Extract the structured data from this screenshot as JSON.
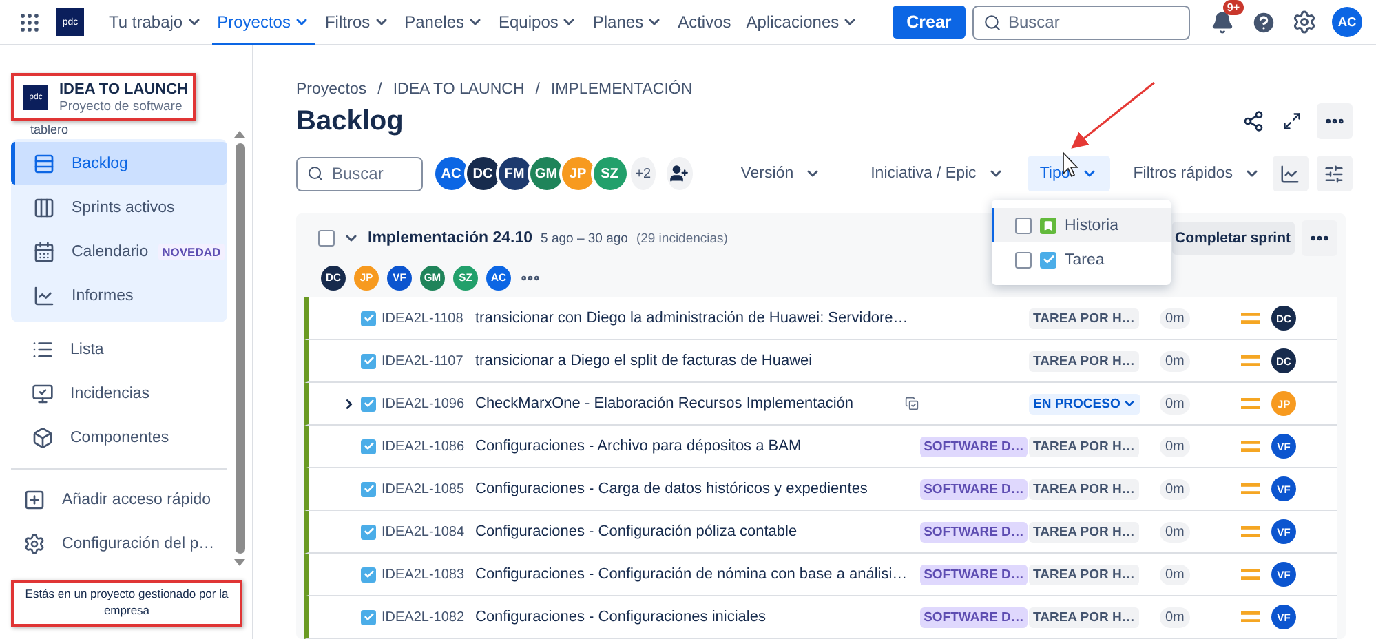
{
  "nav": {
    "logo_text": "pdc",
    "items": [
      {
        "label": "Tu trabajo",
        "dropdown": true,
        "selected": false
      },
      {
        "label": "Proyectos",
        "dropdown": true,
        "selected": true
      },
      {
        "label": "Filtros",
        "dropdown": true,
        "selected": false
      },
      {
        "label": "Paneles",
        "dropdown": true,
        "selected": false
      },
      {
        "label": "Equipos",
        "dropdown": true,
        "selected": false
      },
      {
        "label": "Planes",
        "dropdown": true,
        "selected": false
      },
      {
        "label": "Activos",
        "dropdown": false,
        "selected": false
      },
      {
        "label": "Aplicaciones",
        "dropdown": true,
        "selected": false
      }
    ],
    "create_button": "Crear",
    "search": {
      "placeholder": "Buscar"
    },
    "notifications_badge": "9+",
    "user": {
      "initials": "AC",
      "color": "#0c66e4"
    }
  },
  "sidebar": {
    "project": {
      "logo_text": "pdc",
      "name": "IDEA TO LAUNCH",
      "type": "Proyecto de software"
    },
    "section_label": "tablero",
    "planning_items": [
      {
        "label": "Backlog",
        "selected": true
      },
      {
        "label": "Sprints activos",
        "selected": false
      },
      {
        "label": "Calendario",
        "badge": "NOVEDAD",
        "selected": false
      },
      {
        "label": "Informes",
        "selected": false
      }
    ],
    "items": [
      {
        "label": "Lista",
        "selected": false
      },
      {
        "label": "Incidencias",
        "selected": false
      },
      {
        "label": "Componentes",
        "selected": false
      }
    ],
    "footer_items": [
      {
        "label": "Añadir acceso rápido",
        "selected": false
      },
      {
        "label": "Configuración del p…",
        "selected": false
      }
    ],
    "managed_notice": "Estás en un proyecto gestionado por la empresa"
  },
  "breadcrumbs": {
    "separator": "/",
    "items": [
      "Proyectos",
      "IDEA TO LAUNCH",
      "IMPLEMENTACIÓN"
    ]
  },
  "title": "Backlog",
  "toolbar": {
    "search": {
      "placeholder": "Buscar"
    },
    "avatars": [
      {
        "initials": "AC",
        "color": "#0c66e4"
      },
      {
        "initials": "DC",
        "color": "#172b4d"
      },
      {
        "initials": "FM",
        "color": "#1d3a6e"
      },
      {
        "initials": "GM",
        "color": "#1f845a"
      },
      {
        "initials": "JP",
        "color": "#f79a1f"
      },
      {
        "initials": "SZ",
        "color": "#22a06b"
      }
    ],
    "more_avatars": "+2",
    "filters": [
      {
        "label": "Versión",
        "selected": false
      },
      {
        "label": "Iniciativa / Epic",
        "selected": false
      },
      {
        "label": "Tipo",
        "selected": true
      },
      {
        "label": "Filtros rápidos",
        "selected": false
      }
    ]
  },
  "type_menu": {
    "options": [
      {
        "label": "Historia",
        "checked": false,
        "highlighted": true
      },
      {
        "label": "Tarea",
        "checked": false,
        "highlighted": false
      }
    ]
  },
  "sprint": {
    "checked": false,
    "expanded": true,
    "name": "Implementación 24.10",
    "dates": "5 ago – 30 ago",
    "count": "(29 incidencias)",
    "complete_button": "Completar sprint",
    "assignees": [
      {
        "initials": "DC",
        "color": "#172b4d"
      },
      {
        "initials": "JP",
        "color": "#f79a1f"
      },
      {
        "initials": "VF",
        "color": "#0c55cf"
      },
      {
        "initials": "GM",
        "color": "#1f845a"
      },
      {
        "initials": "SZ",
        "color": "#22a06b"
      },
      {
        "initials": "AC",
        "color": "#0c66e4"
      }
    ],
    "rows": [
      {
        "key": "IDEA2L-1108",
        "summary": "transicionar con Diego la administración de Huawei: Servidore…",
        "has_subtasks": false,
        "status": {
          "text": "TAREA POR H…",
          "kind": "todo"
        },
        "estimate": "0m",
        "assignee": {
          "initials": "DC",
          "color": "#172b4d"
        }
      },
      {
        "key": "IDEA2L-1107",
        "summary": "transicionar a Diego el split de facturas de Huawei",
        "has_subtasks": false,
        "status": {
          "text": "TAREA POR H…",
          "kind": "todo"
        },
        "estimate": "0m",
        "assignee": {
          "initials": "DC",
          "color": "#172b4d"
        }
      },
      {
        "key": "IDEA2L-1096",
        "summary": "CheckMarxOne - Elaboración Recursos Implementación",
        "has_subtasks": true,
        "status": {
          "text": "EN PROCESO",
          "kind": "in_progress"
        },
        "estimate": "0m",
        "assignee": {
          "initials": "JP",
          "color": "#f79a1f"
        }
      },
      {
        "key": "IDEA2L-1086",
        "summary": "Configuraciones - Archivo para dépositos a BAM",
        "label": "SOFTWARE D…",
        "has_subtasks": false,
        "status": {
          "text": "TAREA POR H…",
          "kind": "todo"
        },
        "estimate": "0m",
        "assignee": {
          "initials": "VF",
          "color": "#0c55cf"
        }
      },
      {
        "key": "IDEA2L-1085",
        "summary": "Configuraciones - Carga de datos históricos y expedientes",
        "label": "SOFTWARE D…",
        "has_subtasks": false,
        "status": {
          "text": "TAREA POR H…",
          "kind": "todo"
        },
        "estimate": "0m",
        "assignee": {
          "initials": "VF",
          "color": "#0c55cf"
        }
      },
      {
        "key": "IDEA2L-1084",
        "summary": "Configuraciones - Configuración póliza contable",
        "label": "SOFTWARE D…",
        "has_subtasks": false,
        "status": {
          "text": "TAREA POR H…",
          "kind": "todo"
        },
        "estimate": "0m",
        "assignee": {
          "initials": "VF",
          "color": "#0c55cf"
        }
      },
      {
        "key": "IDEA2L-1083",
        "summary": "Configuraciones - Configuración de nómina con base a análisi…",
        "label": "SOFTWARE D…",
        "has_subtasks": false,
        "status": {
          "text": "TAREA POR H…",
          "kind": "todo"
        },
        "estimate": "0m",
        "assignee": {
          "initials": "VF",
          "color": "#0c55cf"
        }
      },
      {
        "key": "IDEA2L-1082",
        "summary": "Configuraciones - Configuraciones iniciales",
        "label": "SOFTWARE D…",
        "has_subtasks": false,
        "status": {
          "text": "TAREA POR H…",
          "kind": "todo"
        },
        "estimate": "0m",
        "assignee": {
          "initials": "VF",
          "color": "#0c55cf"
        }
      }
    ]
  }
}
